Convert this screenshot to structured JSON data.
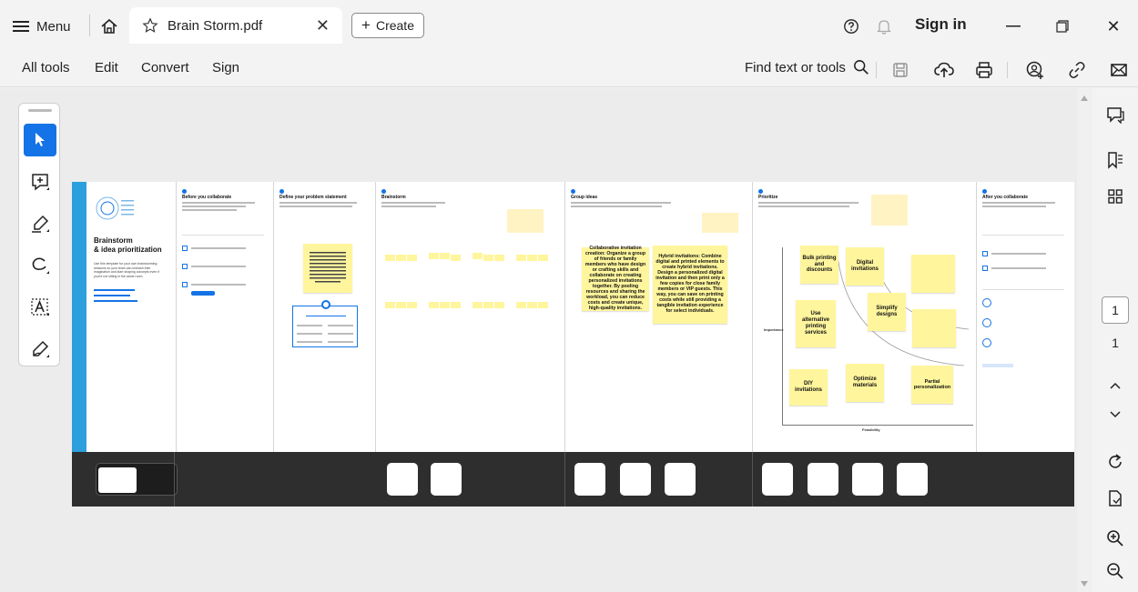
{
  "titlebar": {
    "menu_label": "Menu",
    "tab_title": "Brain Storm.pdf",
    "create_label": "Create",
    "sign_in": "Sign in"
  },
  "toolbar": {
    "left": [
      "All tools",
      "Edit",
      "Convert",
      "Sign"
    ],
    "find_label": "Find text or tools"
  },
  "page_nav": {
    "current": "1",
    "total": "1"
  },
  "colors": {
    "accent": "#1473e6",
    "sticky": "#fff59d",
    "strip": "#2ba0dc"
  },
  "document": {
    "brand_title_1": "Brainstorm",
    "brand_title_2": "& idea prioritization",
    "brand_desc": "Use this template for your own brainstorming sessions so your team can unleash their imagination and start shaping concepts even if you're not sitting in the same room.",
    "frames": [
      "Before you collaborate",
      "Define your problem statement",
      "Brainstorm",
      "Group ideas",
      "Prioritize",
      "After you collaborate"
    ],
    "group_stickies": [
      "Collaborative invitation creation: Organize a group of friends or family members who have design or crafting skills and collaborate on creating personalized invitations together. By pooling resources and sharing the workload, you can reduce costs and create unique, high-quality invitations.",
      "Hybrid invitations: Combine digital and printed elements to create hybrid invitations. Design a personalized digital invitation and then print only a few copies for close family members or VIP guests. This way, you can save on printing costs while still providing a tangible invitation experience for select individuals."
    ],
    "prioritize_stickies": [
      "Bulk printing and discounts",
      "Digital invitations",
      "Use alternative printing services",
      "Simplify designs",
      "DIY invitations",
      "Optimize materials",
      "Partial personalization"
    ],
    "axis_y": "Importance",
    "axis_x": "Feasibility"
  }
}
